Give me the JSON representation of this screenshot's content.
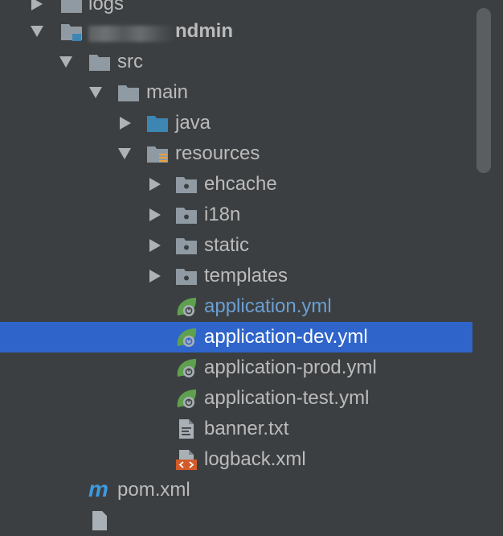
{
  "project_tree": {
    "logs": {
      "label": "logs"
    },
    "project_root": {
      "label": "ndmin"
    },
    "src": {
      "label": "src"
    },
    "main": {
      "label": "main"
    },
    "java": {
      "label": "java"
    },
    "resources": {
      "label": "resources"
    },
    "ehcache": {
      "label": "ehcache"
    },
    "i18n": {
      "label": "i18n"
    },
    "static": {
      "label": "static"
    },
    "templates": {
      "label": "templates"
    },
    "application_yml": {
      "label": "application.yml"
    },
    "application_dev_yml": {
      "label": "application-dev.yml"
    },
    "application_prod_yml": {
      "label": "application-prod.yml"
    },
    "application_test_yml": {
      "label": "application-test.yml"
    },
    "banner_txt": {
      "label": "banner.txt"
    },
    "logback_xml": {
      "label": "logback.xml"
    },
    "pom_xml": {
      "label": "pom.xml"
    },
    "maven_icon_glyph": "m"
  },
  "colors": {
    "background": "#3c3f41",
    "selection": "#2f65ca",
    "text": "#bbbbbb",
    "modified_text": "#6a9fd4",
    "spring_leaf": "#5fa04e",
    "folder": "#8f9aa3",
    "source_folder": "#3d86b3"
  }
}
